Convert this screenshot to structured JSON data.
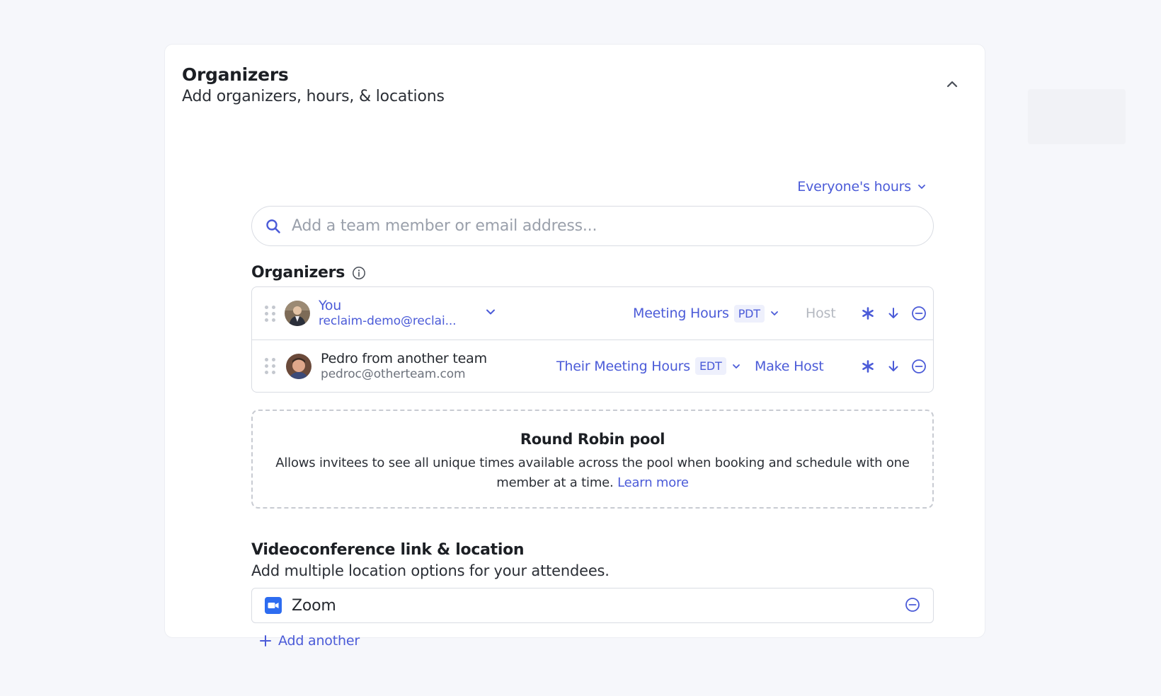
{
  "section": {
    "title": "Organizers",
    "subtitle": "Add organizers, hours, & locations",
    "collapse_icon": "chevron-up-icon"
  },
  "hours_dropdown": {
    "label": "Everyone's hours",
    "icon": "chevron-down-icon"
  },
  "search": {
    "placeholder": "Add a team member or email address...",
    "value": "",
    "icon": "search-icon"
  },
  "organizers": {
    "label": "Organizers",
    "info_icon": "info-icon",
    "rows": [
      {
        "name": "You",
        "email": "reclaim-demo@reclai...",
        "hours_label": "Meeting Hours",
        "timezone": "PDT",
        "host_label": "Host",
        "host_active": false
      },
      {
        "name": "Pedro from another team",
        "email": "pedroc@otherteam.com",
        "hours_label": "Their Meeting Hours",
        "timezone": "EDT",
        "host_label": "Make Host",
        "host_active": true
      }
    ]
  },
  "round_robin": {
    "title": "Round Robin pool",
    "description": "Allows invitees to see all unique times available across the pool when booking and schedule with one member at a time.",
    "link": "Learn more"
  },
  "videoconference": {
    "title": "Videoconference link & location",
    "subtitle": "Add multiple location options for your attendees.",
    "locations": [
      {
        "label": "Zoom",
        "icon": "zoom-icon"
      }
    ],
    "add_label": "Add another"
  },
  "colors": {
    "accent": "#4b5bd8",
    "border": "#d9dce3",
    "zoom_blue": "#2d6cf0",
    "background": "#f6f7fb"
  }
}
